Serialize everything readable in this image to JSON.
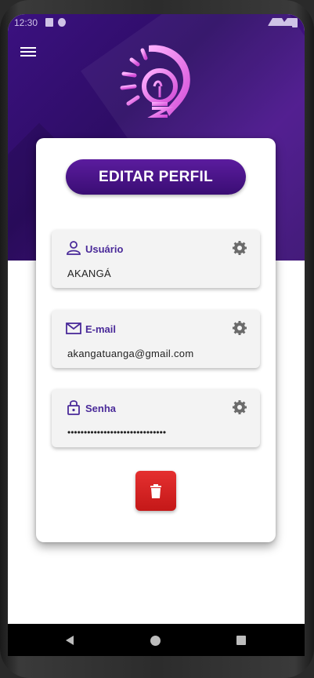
{
  "status_bar": {
    "time": "12:30"
  },
  "header": {
    "menu_icon": "hamburger-menu-icon",
    "logo": "lightbulb-logo"
  },
  "card": {
    "title_button": "EDITAR PERFIL",
    "fields": [
      {
        "label": "Usuário",
        "value": "AKANGÁ",
        "icon": "user-icon"
      },
      {
        "label": "E-mail",
        "value": "akangatuanga@gmail.com",
        "icon": "mail-icon"
      },
      {
        "label": "Senha",
        "value": "••••••••••••••••••••••••••••••",
        "icon": "lock-icon"
      }
    ],
    "delete_icon": "trash-icon"
  },
  "colors": {
    "primary": "#4a148c",
    "label": "#4a2a99",
    "delete": "#d32222"
  }
}
